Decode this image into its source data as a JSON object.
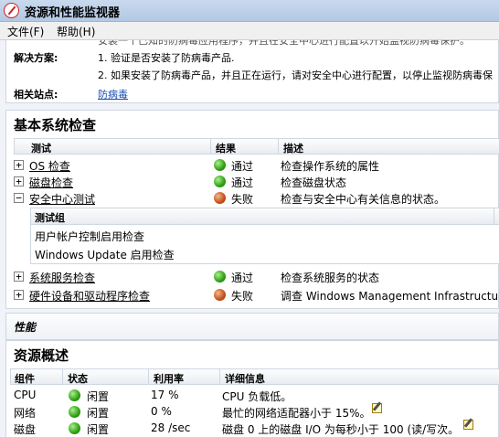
{
  "window": {
    "title": "资源和性能监视器"
  },
  "menu": {
    "file": "文件(F)",
    "help": "帮助(H)"
  },
  "solution": {
    "cut_text": "安装一个已知的防病毒应用程序，并且在安全中心进行配置以开始监视防病毒保护。",
    "resolution_label": "解决方案:",
    "step1": "1. 验证是否安装了防病毒产品.",
    "step2": "2. 如果安装了防病毒产品，并且正在运行，请对安全中心进行配置，以停止监视防病毒保",
    "related_label": "相关站点:",
    "related_link": "防病毒"
  },
  "basic_checks": {
    "title": "基本系统检查",
    "headers": {
      "test": "测试",
      "result": "结果",
      "desc": "描述"
    },
    "rows": [
      {
        "name": "OS 检查",
        "status": "通过",
        "status_color": "green",
        "desc": "检查操作系统的属性",
        "expander": "+"
      },
      {
        "name": "磁盘检查",
        "status": "通过",
        "status_color": "green",
        "desc": "检查磁盘状态",
        "expander": "+"
      },
      {
        "name": "安全中心测试",
        "status": "失败",
        "status_color": "orange",
        "desc": "检查与安全中心有关信息的状态。",
        "expander": "−"
      },
      {
        "name": "系统服务检查",
        "status": "通过",
        "status_color": "green",
        "desc": "检查系统服务的状态",
        "expander": "+"
      },
      {
        "name": "硬件设备和驱动程序检查",
        "status": "失败",
        "status_color": "orange",
        "desc": "调查 Windows Management Infrastructure 支",
        "expander": "+"
      }
    ],
    "subgroup": {
      "header": "测试组",
      "items": [
        "用户帐户控制启用检查",
        "Windows Update 启用检查"
      ]
    }
  },
  "performance": {
    "title": "性能"
  },
  "resource_overview": {
    "title": "资源概述",
    "headers": {
      "component": "组件",
      "status": "状态",
      "usage": "利用率",
      "details": "详细信息"
    },
    "rows": [
      {
        "component": "CPU",
        "status": "闲置",
        "usage": "17 %",
        "details": "CPU 负载低。",
        "edit": false
      },
      {
        "component": "网络",
        "status": "闲置",
        "usage": "0 %",
        "details": "最忙的网络适配器小于 15%。",
        "edit": true
      },
      {
        "component": "磁盘",
        "status": "闲置",
        "usage": "28 /sec",
        "details": "磁盘 0 上的磁盘 I/O 为每秒小于 100 (读/写次。",
        "edit": true
      }
    ]
  },
  "colors": {
    "pass": "#2f9e12",
    "fail": "#c2501c",
    "link": "#1a4fb0",
    "title_bar": "#c9d9ee"
  }
}
